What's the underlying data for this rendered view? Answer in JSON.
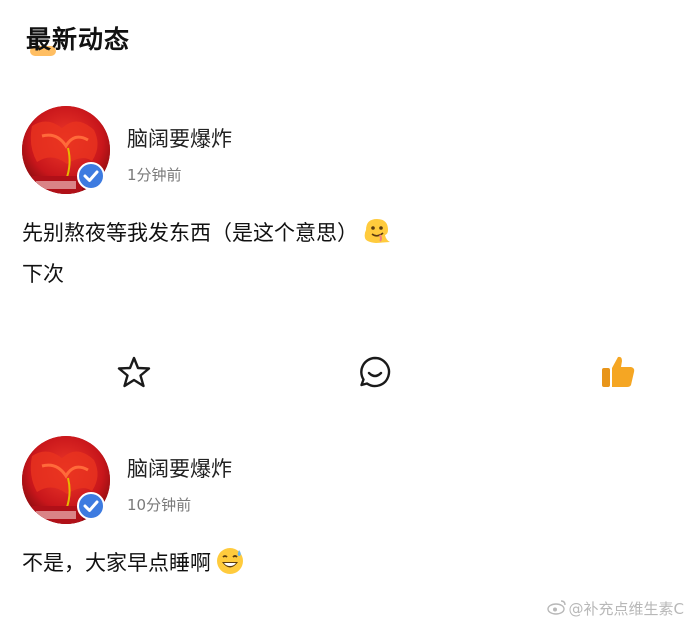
{
  "header": {
    "title": "最新动态"
  },
  "posts": [
    {
      "username": "脑阔要爆炸",
      "time": "1分钟前",
      "lines": [
        "先别熬夜等我发东西（是这个意思）",
        "下次"
      ],
      "emoji": "melting-face-icon"
    },
    {
      "username": "脑阔要爆炸",
      "time": "10分钟前",
      "lines": [
        "不是，大家早点睡啊"
      ],
      "emoji": "grinning-sweat-icon"
    }
  ],
  "actions": [
    "star-icon",
    "comment-icon",
    "thumbs-up-icon"
  ],
  "colors": {
    "verified": "#3d7be0",
    "like": "#f5a623",
    "avatar": "#c0151a"
  },
  "watermark": {
    "text": "@补充点维生素C"
  }
}
